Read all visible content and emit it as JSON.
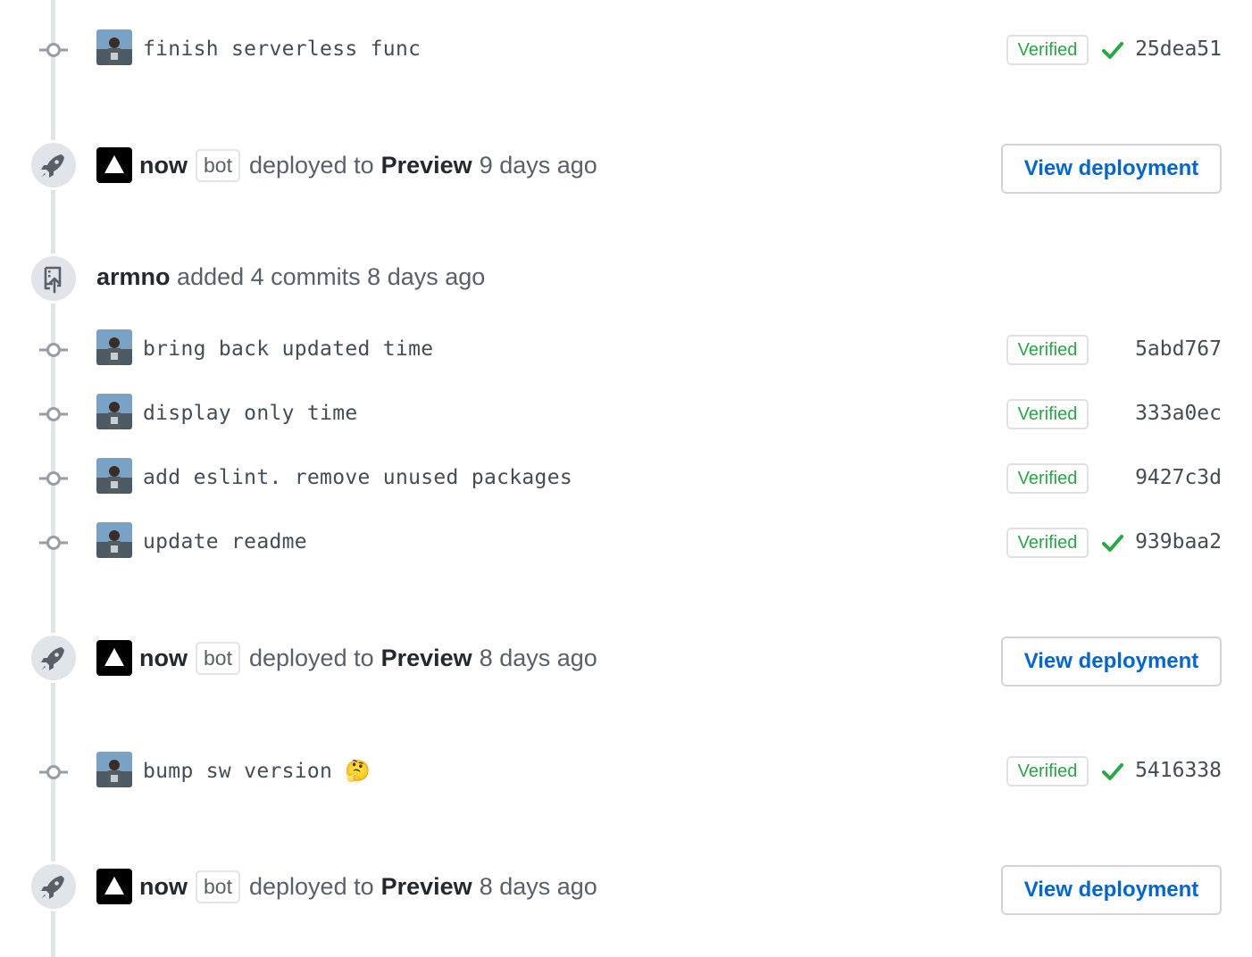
{
  "commits_group_1": [
    {
      "message": "finish serverless func",
      "verified": "Verified",
      "sha": "25dea51",
      "check": true
    }
  ],
  "deploy_1": {
    "author": "now",
    "bot_label": "bot",
    "text_before": "deployed to",
    "environment": "Preview",
    "time": "9 days ago",
    "button": "View deployment"
  },
  "push_event": {
    "author": "armno",
    "text": "added 4 commits",
    "time": "8 days ago"
  },
  "commits_group_2": [
    {
      "message": "bring back updated time",
      "verified": "Verified",
      "sha": "5abd767",
      "check": false
    },
    {
      "message": "display only time",
      "verified": "Verified",
      "sha": "333a0ec",
      "check": false
    },
    {
      "message": "add eslint. remove unused packages",
      "verified": "Verified",
      "sha": "9427c3d",
      "check": false
    },
    {
      "message": "update readme",
      "verified": "Verified",
      "sha": "939baa2",
      "check": true
    }
  ],
  "deploy_2": {
    "author": "now",
    "bot_label": "bot",
    "text_before": "deployed to",
    "environment": "Preview",
    "time": "8 days ago",
    "button": "View deployment"
  },
  "commits_group_3": [
    {
      "message": "bump sw version 🤔",
      "verified": "Verified",
      "sha": "5416338",
      "check": true
    }
  ],
  "deploy_3": {
    "author": "now",
    "bot_label": "bot",
    "text_before": "deployed to",
    "environment": "Preview",
    "time": "8 days ago",
    "button": "View deployment"
  },
  "colors": {
    "verified": "#28a745",
    "link": "#0366d6",
    "check": "#28a745",
    "timeline": "#e1e4e8"
  },
  "icons": {
    "commit": "git-commit-icon",
    "deploy": "rocket-icon",
    "push": "repo-push-icon",
    "check": "check-icon",
    "bot_logo": "now-triangle-logo"
  }
}
